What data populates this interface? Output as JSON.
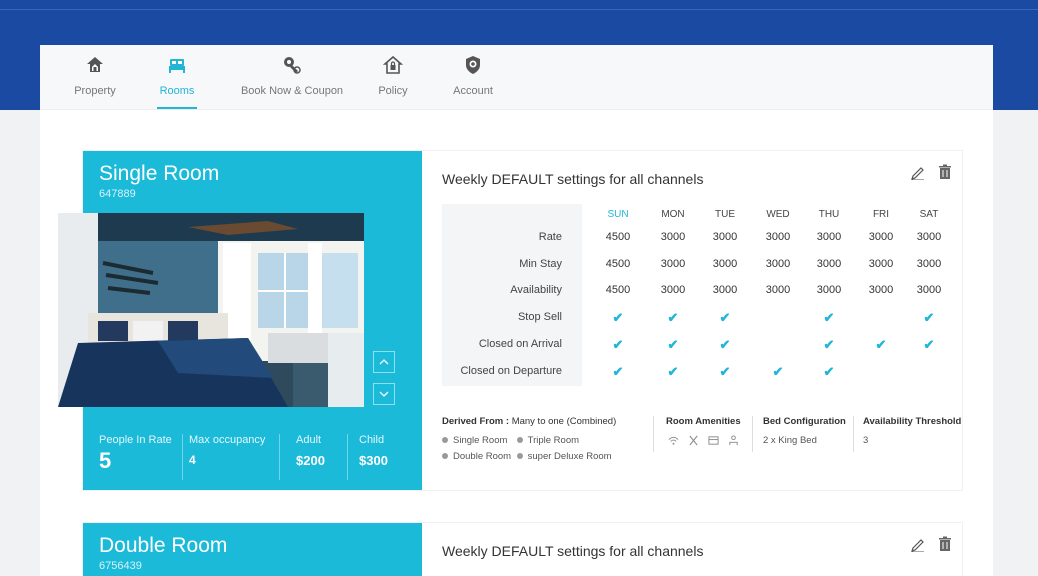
{
  "nav": {
    "items": [
      {
        "label": "Property",
        "icon": "house-icon",
        "active": false
      },
      {
        "label": "Rooms",
        "icon": "bed-icon",
        "active": true
      },
      {
        "label": "Book Now & Coupon",
        "icon": "key-icon",
        "active": false
      },
      {
        "label": "Policy",
        "icon": "home-lock-icon",
        "active": false
      },
      {
        "label": "Account",
        "icon": "shield-icon",
        "active": false
      }
    ]
  },
  "rooms": [
    {
      "name": "Single Room",
      "code": "647889",
      "stats": {
        "people_in_rate_label": "People In Rate",
        "people_in_rate": "5",
        "max_occupancy_label": "Max occupancy",
        "max_occupancy": "4",
        "adult_label": "Adult",
        "adult": "$200",
        "child_label": "Child",
        "child": "$300"
      },
      "weekly": {
        "title": "Weekly DEFAULT settings for all channels",
        "days": [
          "SUN",
          "MON",
          "TUE",
          "WED",
          "THU",
          "FRI",
          "SAT"
        ],
        "rows": [
          {
            "label": "Rate",
            "values": [
              "4500",
              "3000",
              "3000",
              "3000",
              "3000",
              "3000",
              "3000"
            ]
          },
          {
            "label": "Min Stay",
            "values": [
              "4500",
              "3000",
              "3000",
              "3000",
              "3000",
              "3000",
              "3000"
            ]
          },
          {
            "label": "Availability",
            "values": [
              "4500",
              "3000",
              "3000",
              "3000",
              "3000",
              "3000",
              "3000"
            ]
          }
        ],
        "check_rows": [
          {
            "label": "Stop Sell",
            "checks": [
              true,
              true,
              true,
              false,
              true,
              false,
              true
            ]
          },
          {
            "label": "Closed on Arrival",
            "checks": [
              true,
              true,
              true,
              false,
              true,
              true,
              true
            ]
          },
          {
            "label": "Closed on Departure",
            "checks": [
              true,
              true,
              true,
              true,
              true,
              false,
              false
            ]
          }
        ]
      },
      "details": {
        "derived_label": "Derived From :",
        "derived_value": "Many to one (Combined)",
        "derived_rooms": [
          "Single Room",
          "Triple Room",
          "Double Room",
          "super Deluxe Room"
        ],
        "amenities_label": "Room Amenities",
        "amenity_icons": [
          "wifi-icon",
          "dining-icon",
          "card-icon",
          "person-icon"
        ],
        "bed_label": "Bed Configuration",
        "bed_value": "2 x King Bed",
        "threshold_label": "Availability Threshold",
        "threshold_value": "3"
      }
    },
    {
      "name": "Double Room",
      "code": "6756439",
      "weekly": {
        "title": "Weekly DEFAULT settings for all channels"
      }
    }
  ],
  "colors": {
    "header_blue": "#1b4aa3",
    "accent": "#1cbad9",
    "check": "#22b5d6"
  }
}
